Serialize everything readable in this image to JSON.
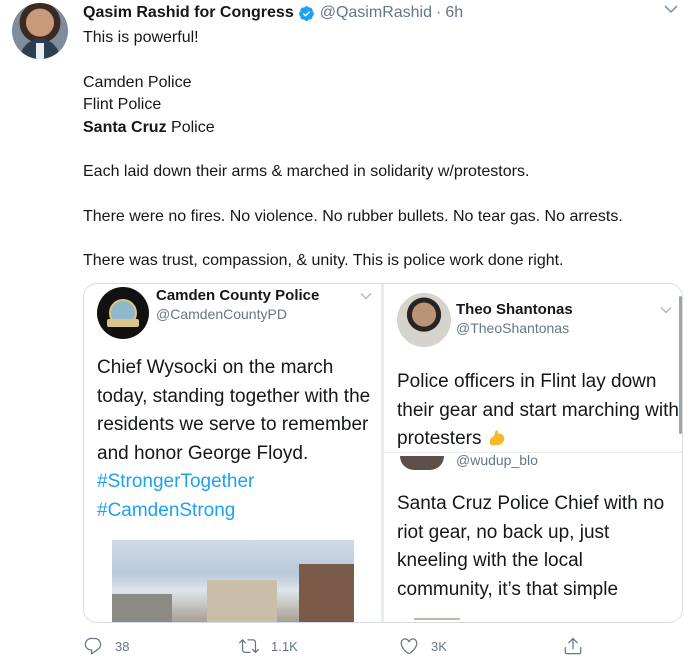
{
  "tweet": {
    "author_name": "Qasim Rashid for Congress",
    "handle": "@QasimRashid",
    "separator": "·",
    "time": "6h",
    "lines": {
      "l1": "This is powerful!",
      "l2": "Camden Police",
      "l3": "Flint Police",
      "l4_bold": "Santa Cruz",
      "l4_rest": " Police",
      "l5": "Each laid down their arms & marched in solidarity w/protestors.",
      "l6": "There were no fires. No violence. No rubber bullets. No tear gas. No arrests.",
      "l7": "There was trust, compassion, & unity. This is police work done right."
    }
  },
  "embed_left": {
    "name": "Camden County Police",
    "handle": "@CamdenCountyPD",
    "text": "Chief Wysocki on the march today, standing together with the residents we serve to remember and honor George Floyd.",
    "hashtag1": "#StrongerTogether",
    "hashtag2": "#CamdenStrong"
  },
  "embed_right_top": {
    "name": "Theo Shantonas",
    "handle": "@TheoShantonas",
    "text": "Police officers in Flint lay down their gear and start marching with protesters",
    "emoji": "flexed-biceps-icon"
  },
  "embed_right_bottom": {
    "handle": "@wudup_blo",
    "text": "Santa Cruz Police Chief with no riot gear, no back up, just kneeling with the local community, it’s that simple"
  },
  "actions": {
    "replies": "38",
    "retweets": "1.1K",
    "likes": "3K"
  },
  "colors": {
    "accent": "#1da1f2",
    "muted": "#657786",
    "text": "#14171a"
  }
}
